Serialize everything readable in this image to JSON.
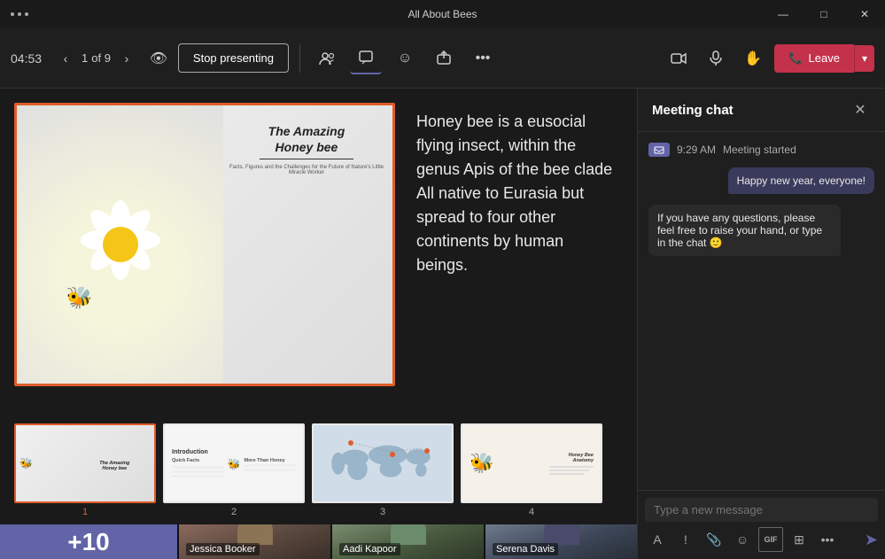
{
  "titleBar": {
    "title": "All About Bees",
    "controls": {
      "minimize": "—",
      "maximize": "□",
      "close": "✕"
    }
  },
  "toolbar": {
    "timer": "04:53",
    "slideNav": {
      "prev": "‹",
      "current": "1",
      "of": "of 9",
      "next": "›"
    },
    "stopPresenting": "Stop presenting",
    "leave": "Leave",
    "dotsMenu": "•••"
  },
  "presentation": {
    "descriptionText": "Honey bee is a eusocial flying insect, within the genus Apis of the bee clade\nAll native to Eurasia but spread to four other continents by human beings.",
    "slideTitle": "The Amazing\nHoney bee",
    "slideSubtitle": "Facts, Figures and the Challenges for the Future of\nNature's Little Miracle Worker"
  },
  "thumbnails": [
    {
      "number": "1",
      "label": "Slide 1",
      "active": true
    },
    {
      "number": "2",
      "label": "Introduction",
      "active": false
    },
    {
      "number": "3",
      "label": "Slide 3",
      "active": false
    },
    {
      "number": "4",
      "label": "Honey Bee Anatomy",
      "active": false
    }
  ],
  "videoTiles": {
    "more": "+10",
    "people": [
      {
        "name": "Jessica Booker"
      },
      {
        "name": "Aadi Kapoor"
      },
      {
        "name": "Serena Davis"
      }
    ]
  },
  "chat": {
    "title": "Meeting chat",
    "closeBtn": "✕",
    "systemMsg": {
      "time": "9:29 AM",
      "text": "Meeting started"
    },
    "messages": [
      {
        "text": "Happy new year, everyone!",
        "type": "right"
      },
      {
        "text": "If you have any questions, please feel free to raise your hand, or type in the chat 🙂",
        "type": "left"
      }
    ],
    "inputPlaceholder": "Type a new message",
    "toolbar": {
      "format": "A",
      "exclamation": "!",
      "attach": "📎",
      "emoji": "☺",
      "gif": "GIF",
      "more": "⊞",
      "moreOptions": "•••",
      "send": "➤"
    }
  }
}
